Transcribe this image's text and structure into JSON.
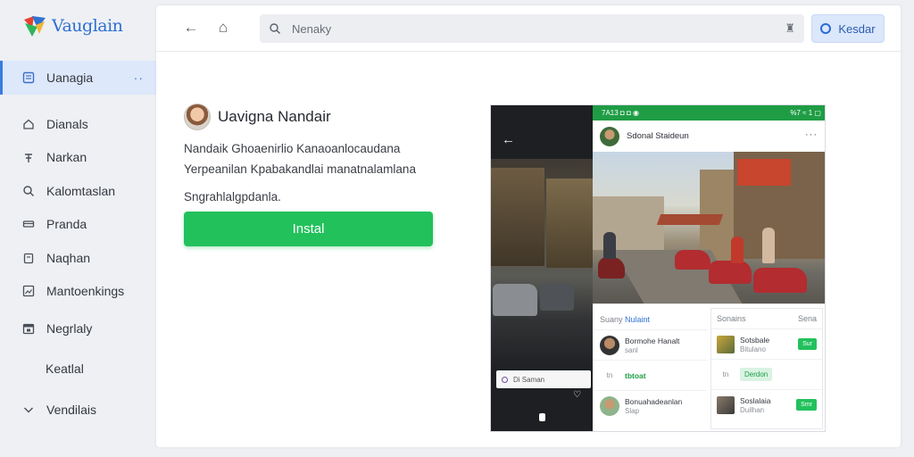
{
  "app": {
    "name": "Vauglain"
  },
  "colors": {
    "accent": "#3a7be0",
    "install": "#22c15c",
    "status_green": "#1f9d45"
  },
  "sidebar": {
    "active": {
      "label": "Uanagia",
      "icon": "document-icon",
      "more": "··"
    },
    "items": [
      {
        "label": "Dianals",
        "icon": "home-icon"
      },
      {
        "label": "Narkan",
        "icon": "push-pin-icon"
      },
      {
        "label": "Kalomtaslan",
        "icon": "search-icon"
      },
      {
        "label": "Pranda",
        "icon": "card-icon"
      },
      {
        "label": "Naqhan",
        "icon": "clipboard-icon"
      },
      {
        "label": "Mantoenkings",
        "icon": "image-icon"
      },
      {
        "label": "Negrlaly",
        "icon": "calendar-icon"
      },
      {
        "label": "Keatlal",
        "icon": ""
      },
      {
        "label": "Vendilais",
        "icon": "chevron-down-icon"
      }
    ]
  },
  "topbar": {
    "back_icon": "←",
    "home_icon": "⌂",
    "search_placeholder": "Nenaky",
    "mic_icon": "♜",
    "header_button": "Kesdar"
  },
  "app_info": {
    "title": "Uavigna Nandair",
    "desc_line1": "Nandaik Ghoaenirlio Kanaoanlocaudana",
    "desc_line2": "Yerpeanilan Kpabakandlai manatnalamlana",
    "desc_line3": "Sngrahlalgpdanla.",
    "install_label": "Instal"
  },
  "preview": {
    "left": {
      "back": "←",
      "field_text": "Di Saman",
      "heart": "♡"
    },
    "status": {
      "left": "7A13 ◘ ◘ ◉",
      "right": "%7 ≈ 1 ▢"
    },
    "post_author": "Sdonal Staideun",
    "post_more": "···",
    "col1": {
      "title": "Suany",
      "tag": "Nulaint",
      "row1": "Bormohe Hanalt",
      "row1_sub": "sanl",
      "row2_icon": "tn",
      "row2_text": "tbtoat",
      "row3": "Bonuahadeanlan",
      "row3_sub": "Slap"
    },
    "col2": {
      "title": "Sonains",
      "right": "Sena",
      "row1": "Sotsbale",
      "row1_sub": "Bitulano",
      "row1_chip": "Sur",
      "row2_icon": "tn",
      "row2_chip": "Derdon",
      "row3": "Soslalaia",
      "row3_sub": "Duilhan",
      "row3_chip": "Smr"
    }
  }
}
